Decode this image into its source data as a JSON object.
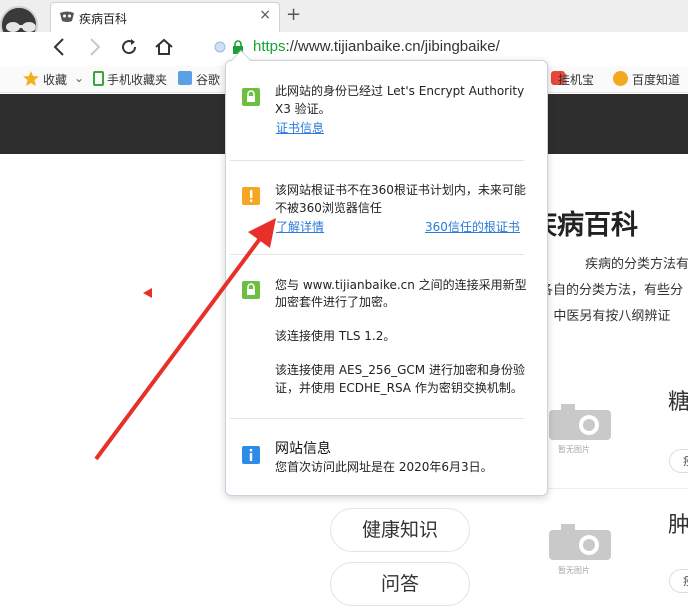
{
  "tab": {
    "title": "疾病百科",
    "close": "×",
    "new": "+"
  },
  "url": {
    "scheme": "https",
    "rest": "://www.tijianbaike.cn/jibingbaike/"
  },
  "bookmarks": [
    "收藏",
    "手机收藏夹",
    "谷歌",
    "挂机宝",
    "百度知道"
  ],
  "page": {
    "heading": "疾病百科",
    "line1": "疾病的分类方法有",
    "line2": "各自的分类方法，有些分",
    "line3": "), 中医另有按八纲辨证",
    "side1": "糖",
    "side2": "肿",
    "chip": "疾",
    "noimage": "暂无图片",
    "nav": [
      "健康知识",
      "问答"
    ]
  },
  "popup": {
    "s1": {
      "line1": "此网站的身份已经过 Let's Encrypt Authority",
      "line2": "X3 验证。",
      "link": "证书信息"
    },
    "s2": {
      "line1": "该网站根证书不在360根证书计划内，未来可能",
      "line2": "不被360浏览器信任",
      "link_left": "了解详情",
      "link_right": "360信任的根证书"
    },
    "s3": {
      "line1": "您与 www.tijianbaike.cn 之间的连接采用新型",
      "line2": "加密套件进行了加密。",
      "tls": "该连接使用 TLS 1.2。",
      "cipher1": "该连接使用 AES_256_GCM 进行加密和身份验",
      "cipher2": "证，并使用 ECDHE_RSA 作为密钥交换机制。"
    },
    "s4": {
      "title": "网站信息",
      "text": "您首次访问此网址是在 2020年6月3日。"
    }
  },
  "colors": {
    "secure_green": "#6cbf3f",
    "warning_orange": "#f5a623",
    "info_blue": "#2e8ce6",
    "link": "#2b7bd8",
    "arrow_red": "#e8302a"
  },
  "icons": [
    "incognito-icon",
    "back-icon",
    "forward-icon",
    "refresh-icon",
    "home-icon",
    "lock-icon",
    "warning-icon",
    "info-icon",
    "star-icon"
  ]
}
